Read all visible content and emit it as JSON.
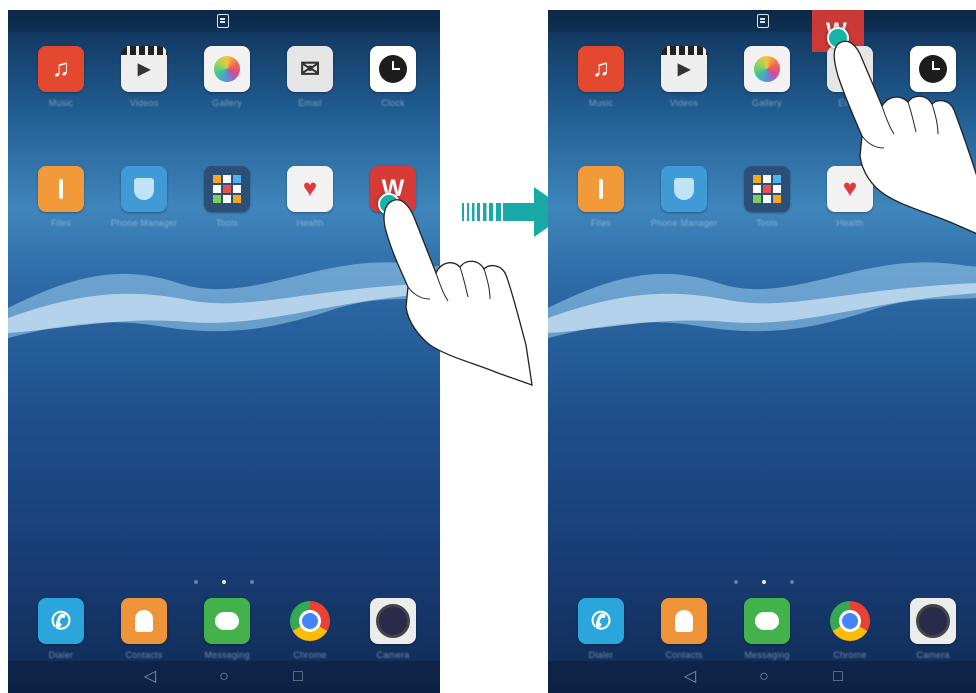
{
  "screens": [
    {
      "id": "before",
      "rows": [
        [
          {
            "name": "music",
            "label": "Music",
            "color": "#e4482f",
            "glyph": "♫"
          },
          {
            "name": "videos",
            "label": "Videos",
            "color": "#eeeeee",
            "glyph": "▶"
          },
          {
            "name": "gallery",
            "label": "Gallery",
            "color": "#f2f2f2",
            "glyph": ""
          },
          {
            "name": "email",
            "label": "Email",
            "color": "#e6e6e6",
            "glyph": "✉"
          },
          {
            "name": "clock",
            "label": "Clock",
            "color": "#ffffff",
            "glyph": ""
          }
        ],
        [
          {
            "name": "files",
            "label": "Files",
            "color": "#f29a3a",
            "glyph": ""
          },
          {
            "name": "phone-manager",
            "label": "Phone Manager",
            "color": "#3f9ad6",
            "glyph": ""
          },
          {
            "name": "tools",
            "label": "Tools",
            "color": "#2c4f78",
            "glyph": ""
          },
          {
            "name": "health",
            "label": "Health",
            "color": "#f2f2f2",
            "glyph": "♥"
          },
          {
            "name": "wps",
            "label": "WPS",
            "color": "#d63a36",
            "glyph": "W"
          }
        ]
      ],
      "dock": [
        {
          "name": "phone",
          "label": "Dialer",
          "color": "#2aa6dc",
          "glyph": "✆"
        },
        {
          "name": "contacts",
          "label": "Contacts",
          "color": "#f0943a",
          "glyph": ""
        },
        {
          "name": "messaging",
          "label": "Messaging",
          "color": "#43b24a",
          "glyph": ""
        },
        {
          "name": "chrome",
          "label": "Chrome",
          "color": "#ffffff",
          "glyph": ""
        },
        {
          "name": "camera",
          "label": "Camera",
          "color": "#ececec",
          "glyph": ""
        }
      ]
    },
    {
      "id": "after",
      "rows": [
        [
          {
            "name": "music",
            "label": "Music",
            "color": "#e4482f",
            "glyph": "♫"
          },
          {
            "name": "videos",
            "label": "Videos",
            "color": "#eeeeee",
            "glyph": "▶"
          },
          {
            "name": "gallery",
            "label": "Gallery",
            "color": "#f2f2f2",
            "glyph": ""
          },
          {
            "name": "email",
            "label": "Email",
            "color": "#e6e6e6",
            "glyph": ""
          },
          {
            "name": "clock",
            "label": "Clock",
            "color": "#ffffff",
            "glyph": ""
          }
        ],
        [
          {
            "name": "files",
            "label": "Files",
            "color": "#f29a3a",
            "glyph": ""
          },
          {
            "name": "phone-manager",
            "label": "Phone Manager",
            "color": "#3f9ad6",
            "glyph": ""
          },
          {
            "name": "tools",
            "label": "Tools",
            "color": "#2c4f78",
            "glyph": ""
          },
          {
            "name": "health",
            "label": "Health",
            "color": "#f2f2f2",
            "glyph": "♥"
          }
        ]
      ],
      "dock": [
        {
          "name": "phone",
          "label": "Dialer",
          "color": "#2aa6dc",
          "glyph": "✆"
        },
        {
          "name": "contacts",
          "label": "Contacts",
          "color": "#f0943a",
          "glyph": ""
        },
        {
          "name": "messaging",
          "label": "Messaging",
          "color": "#43b24a",
          "glyph": ""
        },
        {
          "name": "chrome",
          "label": "Chrome",
          "color": "#ffffff",
          "glyph": ""
        },
        {
          "name": "camera",
          "label": "Camera",
          "color": "#ececec",
          "glyph": ""
        }
      ]
    }
  ],
  "navbar": {
    "back": "◁",
    "home": "○",
    "recents": "□"
  },
  "colors": {
    "accent_teal": "#17b3a9",
    "arrow": "#19aaa8",
    "wps_red": "#d63a36"
  }
}
